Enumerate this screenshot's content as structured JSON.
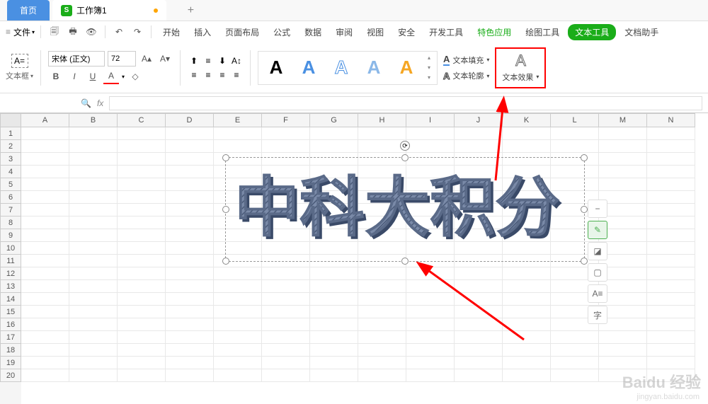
{
  "tabs": {
    "home": "首页",
    "workbook_icon": "S",
    "workbook": "工作簿1"
  },
  "file_menu": "文件",
  "menus": {
    "start": "开始",
    "insert": "插入",
    "page_layout": "页面布局",
    "formula": "公式",
    "data": "数据",
    "review": "审阅",
    "view": "视图",
    "security": "安全",
    "dev_tools": "开发工具",
    "special": "特色应用",
    "drawing_tools": "绘图工具",
    "text_tools": "文本工具",
    "doc_helper": "文档助手"
  },
  "toolbar": {
    "textbox_label": "文本框",
    "font_name": "宋体 (正文)",
    "font_size": "72",
    "bold": "B",
    "italic": "I",
    "underline": "U",
    "wordart_a": "A",
    "text_fill": "文本填充",
    "text_outline": "文本轮廓",
    "text_effects": "文本效果"
  },
  "columns": [
    "A",
    "B",
    "C",
    "D",
    "E",
    "F",
    "G",
    "H",
    "I",
    "J",
    "K",
    "L",
    "M",
    "N"
  ],
  "rows": [
    "1",
    "2",
    "3",
    "4",
    "5",
    "6",
    "7",
    "8",
    "9",
    "10",
    "11",
    "12",
    "13",
    "14",
    "15",
    "16",
    "17",
    "18",
    "19",
    "20"
  ],
  "wordart_text": "中科大积分",
  "float_toolbar": {
    "minus": "−",
    "char": "字"
  },
  "watermark": {
    "main": "Baidu 经验",
    "sub": "jingyan.baidu.com"
  }
}
